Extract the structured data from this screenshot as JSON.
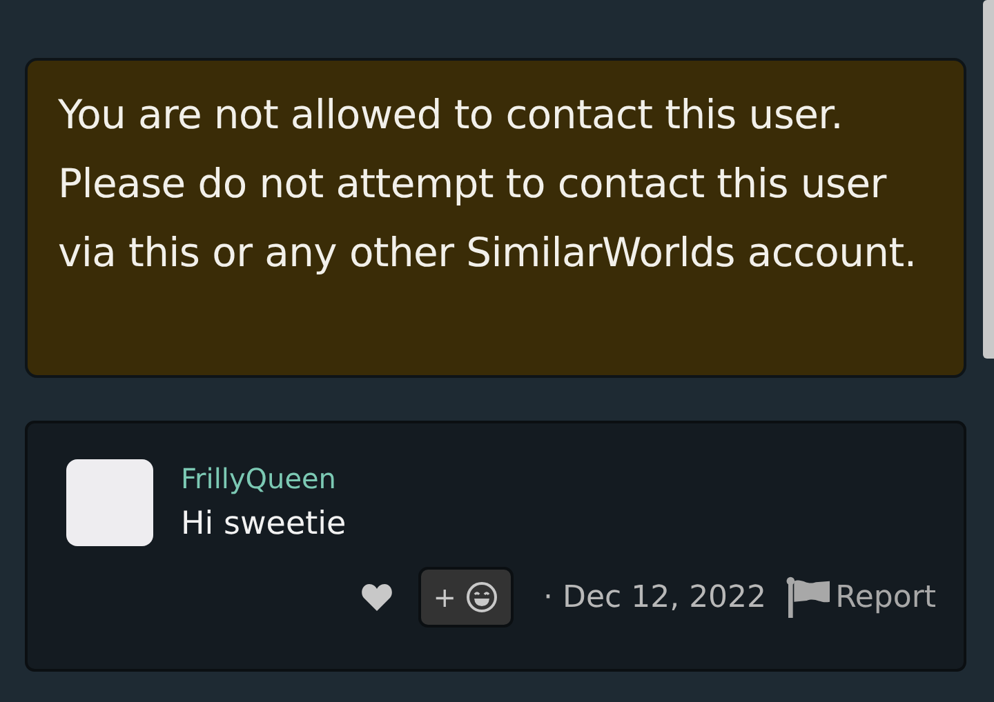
{
  "notice": {
    "message": "You are not allowed to contact this user. Please do not attempt to contact this user via this or any other SimilarWorlds account."
  },
  "comment": {
    "author": "FrillyQueen",
    "text": "Hi sweetie",
    "reaction_label": "+",
    "date": "· Dec 12, 2022",
    "report_label": "Report"
  }
}
